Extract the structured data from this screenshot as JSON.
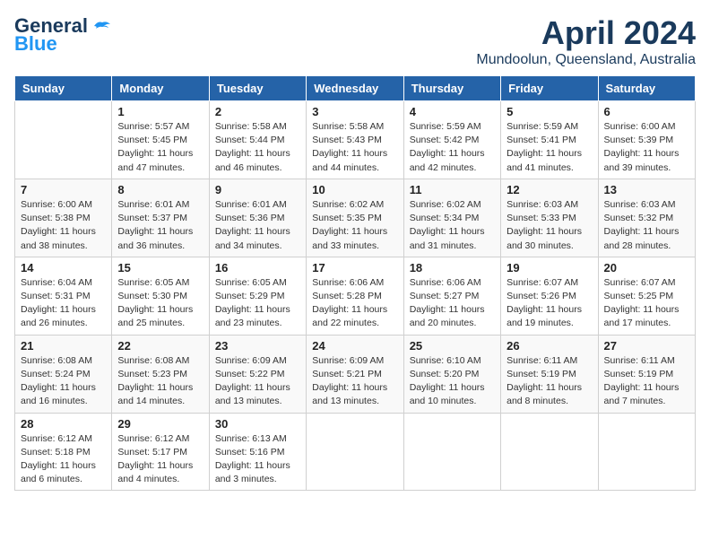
{
  "logo": {
    "line1": "General",
    "line2": "Blue"
  },
  "title": "April 2024",
  "location": "Mundoolun, Queensland, Australia",
  "days_header": [
    "Sunday",
    "Monday",
    "Tuesday",
    "Wednesday",
    "Thursday",
    "Friday",
    "Saturday"
  ],
  "weeks": [
    [
      {
        "day": "",
        "info": ""
      },
      {
        "day": "1",
        "info": "Sunrise: 5:57 AM\nSunset: 5:45 PM\nDaylight: 11 hours\nand 47 minutes."
      },
      {
        "day": "2",
        "info": "Sunrise: 5:58 AM\nSunset: 5:44 PM\nDaylight: 11 hours\nand 46 minutes."
      },
      {
        "day": "3",
        "info": "Sunrise: 5:58 AM\nSunset: 5:43 PM\nDaylight: 11 hours\nand 44 minutes."
      },
      {
        "day": "4",
        "info": "Sunrise: 5:59 AM\nSunset: 5:42 PM\nDaylight: 11 hours\nand 42 minutes."
      },
      {
        "day": "5",
        "info": "Sunrise: 5:59 AM\nSunset: 5:41 PM\nDaylight: 11 hours\nand 41 minutes."
      },
      {
        "day": "6",
        "info": "Sunrise: 6:00 AM\nSunset: 5:39 PM\nDaylight: 11 hours\nand 39 minutes."
      }
    ],
    [
      {
        "day": "7",
        "info": "Sunrise: 6:00 AM\nSunset: 5:38 PM\nDaylight: 11 hours\nand 38 minutes."
      },
      {
        "day": "8",
        "info": "Sunrise: 6:01 AM\nSunset: 5:37 PM\nDaylight: 11 hours\nand 36 minutes."
      },
      {
        "day": "9",
        "info": "Sunrise: 6:01 AM\nSunset: 5:36 PM\nDaylight: 11 hours\nand 34 minutes."
      },
      {
        "day": "10",
        "info": "Sunrise: 6:02 AM\nSunset: 5:35 PM\nDaylight: 11 hours\nand 33 minutes."
      },
      {
        "day": "11",
        "info": "Sunrise: 6:02 AM\nSunset: 5:34 PM\nDaylight: 11 hours\nand 31 minutes."
      },
      {
        "day": "12",
        "info": "Sunrise: 6:03 AM\nSunset: 5:33 PM\nDaylight: 11 hours\nand 30 minutes."
      },
      {
        "day": "13",
        "info": "Sunrise: 6:03 AM\nSunset: 5:32 PM\nDaylight: 11 hours\nand 28 minutes."
      }
    ],
    [
      {
        "day": "14",
        "info": "Sunrise: 6:04 AM\nSunset: 5:31 PM\nDaylight: 11 hours\nand 26 minutes."
      },
      {
        "day": "15",
        "info": "Sunrise: 6:05 AM\nSunset: 5:30 PM\nDaylight: 11 hours\nand 25 minutes."
      },
      {
        "day": "16",
        "info": "Sunrise: 6:05 AM\nSunset: 5:29 PM\nDaylight: 11 hours\nand 23 minutes."
      },
      {
        "day": "17",
        "info": "Sunrise: 6:06 AM\nSunset: 5:28 PM\nDaylight: 11 hours\nand 22 minutes."
      },
      {
        "day": "18",
        "info": "Sunrise: 6:06 AM\nSunset: 5:27 PM\nDaylight: 11 hours\nand 20 minutes."
      },
      {
        "day": "19",
        "info": "Sunrise: 6:07 AM\nSunset: 5:26 PM\nDaylight: 11 hours\nand 19 minutes."
      },
      {
        "day": "20",
        "info": "Sunrise: 6:07 AM\nSunset: 5:25 PM\nDaylight: 11 hours\nand 17 minutes."
      }
    ],
    [
      {
        "day": "21",
        "info": "Sunrise: 6:08 AM\nSunset: 5:24 PM\nDaylight: 11 hours\nand 16 minutes."
      },
      {
        "day": "22",
        "info": "Sunrise: 6:08 AM\nSunset: 5:23 PM\nDaylight: 11 hours\nand 14 minutes."
      },
      {
        "day": "23",
        "info": "Sunrise: 6:09 AM\nSunset: 5:22 PM\nDaylight: 11 hours\nand 13 minutes."
      },
      {
        "day": "24",
        "info": "Sunrise: 6:09 AM\nSunset: 5:21 PM\nDaylight: 11 hours\nand 13 minutes."
      },
      {
        "day": "25",
        "info": "Sunrise: 6:10 AM\nSunset: 5:20 PM\nDaylight: 11 hours\nand 10 minutes."
      },
      {
        "day": "26",
        "info": "Sunrise: 6:11 AM\nSunset: 5:19 PM\nDaylight: 11 hours\nand 8 minutes."
      },
      {
        "day": "27",
        "info": "Sunrise: 6:11 AM\nSunset: 5:19 PM\nDaylight: 11 hours\nand 7 minutes."
      }
    ],
    [
      {
        "day": "28",
        "info": "Sunrise: 6:12 AM\nSunset: 5:18 PM\nDaylight: 11 hours\nand 6 minutes."
      },
      {
        "day": "29",
        "info": "Sunrise: 6:12 AM\nSunset: 5:17 PM\nDaylight: 11 hours\nand 4 minutes."
      },
      {
        "day": "30",
        "info": "Sunrise: 6:13 AM\nSunset: 5:16 PM\nDaylight: 11 hours\nand 3 minutes."
      },
      {
        "day": "",
        "info": ""
      },
      {
        "day": "",
        "info": ""
      },
      {
        "day": "",
        "info": ""
      },
      {
        "day": "",
        "info": ""
      }
    ]
  ]
}
